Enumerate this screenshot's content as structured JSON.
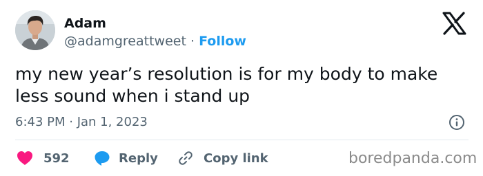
{
  "author": {
    "name": "Adam",
    "handle": "@adamgreattweet",
    "separator": "·",
    "follow_label": "Follow"
  },
  "tweet": {
    "text": "my new year’s resolution is for my body to make less sound when i stand up",
    "timestamp": "6:43 PM · Jan 1, 2023"
  },
  "actions": {
    "likes_count": "592",
    "reply_label": "Reply",
    "copy_label": "Copy link"
  },
  "icons": {
    "logo": "x-logo-icon",
    "info": "info-icon",
    "like": "heart-icon",
    "reply": "speech-bubble-icon",
    "copy": "link-icon"
  },
  "colors": {
    "like": "#f91880",
    "reply": "#1d9bf0",
    "follow": "#1d9bf0",
    "secondary_text": "#536471"
  },
  "watermark": "boredpanda.com"
}
